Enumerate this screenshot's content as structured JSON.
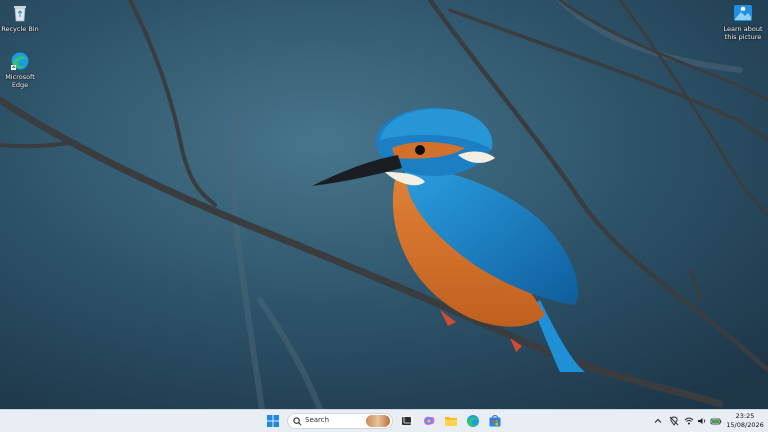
{
  "desktop": {
    "icons": [
      {
        "label": "Recycle Bin",
        "icon": "recycle-bin-icon"
      },
      {
        "label": "Microsoft Edge",
        "icon": "edge-icon"
      },
      {
        "label": "Learn about this picture",
        "icon": "learn-picture-icon"
      }
    ]
  },
  "taskbar": {
    "search_placeholder": "Search",
    "apps": [
      "start-icon",
      "task-view-icon",
      "copilot-icon",
      "file-explorer-icon",
      "edge-icon",
      "store-icon"
    ],
    "tray": [
      "chevron-up-icon",
      "location-off-icon",
      "wifi-icon",
      "volume-icon",
      "battery-icon"
    ]
  },
  "clock": {
    "time": "23:25",
    "date": "15/08/2026"
  },
  "colors": {
    "taskbar": "#e8eef4",
    "kingfisher_blue": "#1f8fd6",
    "kingfisher_orange": "#d7742e",
    "background": "#2b4f64"
  }
}
